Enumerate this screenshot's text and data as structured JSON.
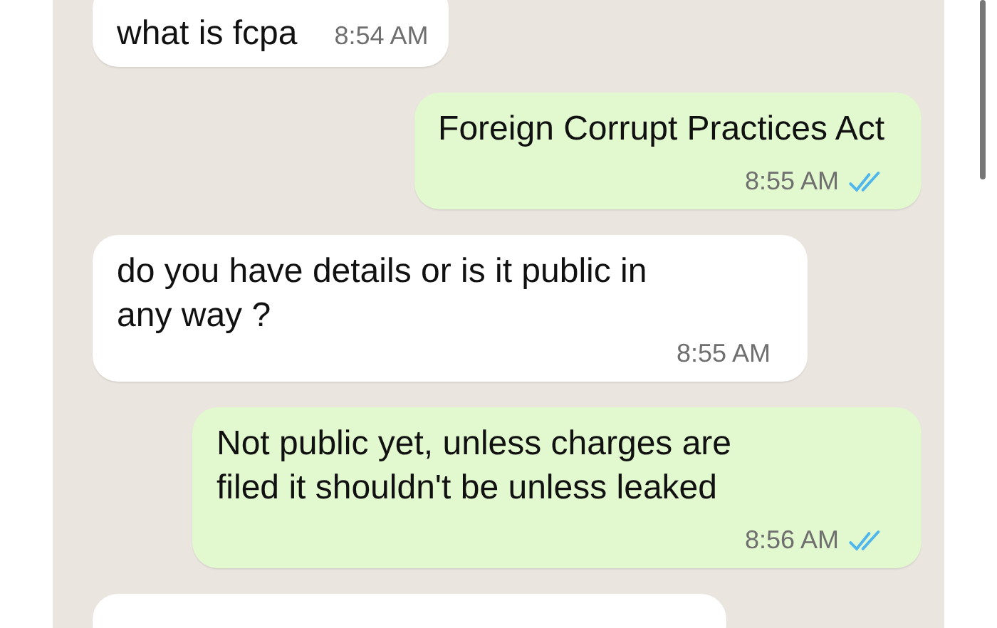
{
  "messages": [
    {
      "kind": "incoming",
      "text": "what is fcpa",
      "time": "8:54 AM"
    },
    {
      "kind": "outgoing",
      "text": "Foreign Corrupt Practices Act",
      "time": "8:55 AM",
      "read": true
    },
    {
      "kind": "incoming",
      "text": "do you have details or is it public in any way ?",
      "time": "8:55 AM"
    },
    {
      "kind": "outgoing",
      "text": "Not public yet, unless charges are filed it shouldn't be unless leaked",
      "time": "8:56 AM",
      "read": true
    },
    {
      "kind": "incoming",
      "cut_off": true
    }
  ]
}
